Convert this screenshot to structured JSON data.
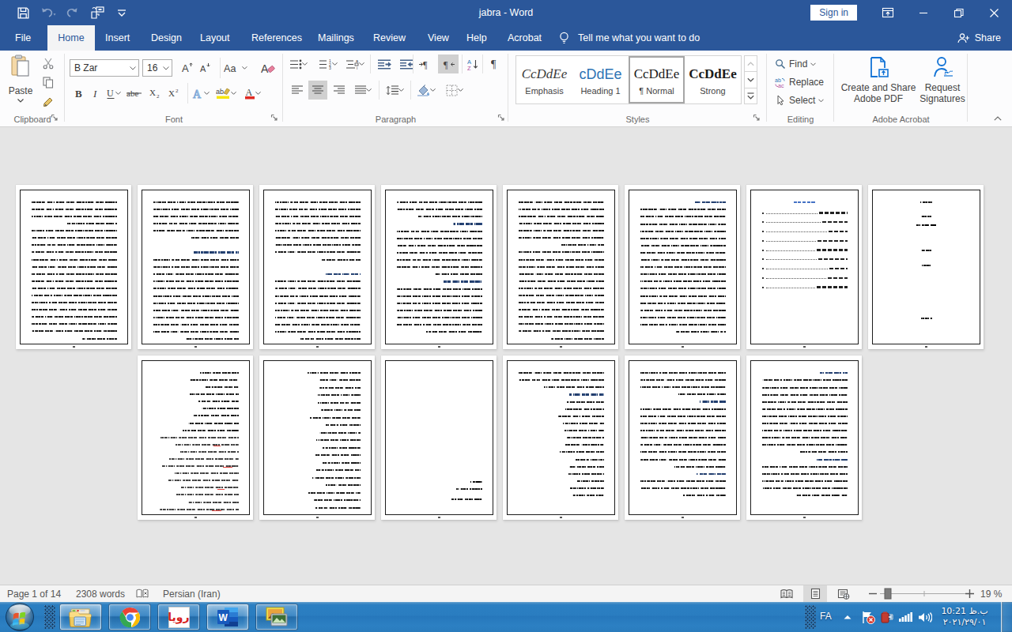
{
  "window": {
    "title": "jabra  -  Word",
    "signin_label": "Sign in"
  },
  "tabs": {
    "items": [
      {
        "label": "File",
        "active": false
      },
      {
        "label": "Home",
        "active": true
      },
      {
        "label": "Insert",
        "active": false
      },
      {
        "label": "Design",
        "active": false
      },
      {
        "label": "Layout",
        "active": false
      },
      {
        "label": "References",
        "active": false
      },
      {
        "label": "Mailings",
        "active": false
      },
      {
        "label": "Review",
        "active": false
      },
      {
        "label": "View",
        "active": false
      },
      {
        "label": "Help",
        "active": false
      },
      {
        "label": "Acrobat",
        "active": false
      }
    ],
    "tellme_label": "Tell me what you want to do",
    "share_label": "Share"
  },
  "ribbon": {
    "clipboard": {
      "label": "Clipboard",
      "paste_label": "Paste"
    },
    "font": {
      "label": "Font",
      "font_name": "B Zar",
      "font_size": "16"
    },
    "paragraph": {
      "label": "Paragraph"
    },
    "styles": {
      "label": "Styles",
      "items": [
        {
          "sample": "CcDdEe",
          "name": "Emphasis",
          "kind": "emphasis",
          "selected": false
        },
        {
          "sample": "cDdEe",
          "name": "Heading 1",
          "kind": "heading1",
          "selected": false
        },
        {
          "sample": "CcDdEe",
          "name": "¶ Normal",
          "kind": "normal",
          "selected": true
        },
        {
          "sample": "CcDdEe",
          "name": "Strong",
          "kind": "strong",
          "selected": false
        }
      ]
    },
    "editing": {
      "label": "Editing",
      "find_label": "Find",
      "replace_label": "Replace",
      "select_label": "Select"
    },
    "acrobat": {
      "label": "Adobe Acrobat",
      "create_pdf_label": "Create and Share\nAdobe PDF",
      "request_sig_label": "Request\nSignatures"
    }
  },
  "document": {
    "zoom_percent": 19,
    "rows": [
      8,
      6
    ],
    "pages": [
      {
        "kind": "body",
        "seed": 11,
        "blocks": [
          [
            "p",
            4,
            58
          ],
          [
            "p",
            16,
            40
          ]
        ]
      },
      {
        "kind": "body",
        "seed": 22,
        "blocks": [
          [
            "p",
            6,
            55
          ],
          [
            "g"
          ],
          [
            "h",
            52
          ],
          [
            "p",
            12,
            62
          ]
        ]
      },
      {
        "kind": "body",
        "seed": 33,
        "blocks": [
          [
            "p",
            9,
            45
          ],
          [
            "g"
          ],
          [
            "h",
            40
          ],
          [
            "p",
            9,
            70
          ]
        ]
      },
      {
        "kind": "body",
        "seed": 44,
        "blocks": [
          [
            "p",
            3,
            75
          ],
          [
            "h",
            34
          ],
          [
            "p",
            7,
            55
          ],
          [
            "h",
            46
          ],
          [
            "p",
            7,
            65
          ]
        ]
      },
      {
        "kind": "body",
        "seed": 55,
        "blocks": [
          [
            "p",
            7,
            50
          ],
          [
            "p",
            13,
            62
          ]
        ]
      },
      {
        "kind": "body",
        "seed": 66,
        "blocks": [
          [
            "h",
            36
          ],
          [
            "p",
            18,
            58
          ]
        ]
      },
      {
        "kind": "toc",
        "seed": 77,
        "entries": 9,
        "heading_w": 26
      },
      {
        "kind": "title",
        "seed": 88
      },
      {
        "kind": "refs",
        "seed": 99,
        "persian_lines": 9,
        "latin_lines": 11
      },
      {
        "kind": "list",
        "seed": 111,
        "lines": 19,
        "wmin": 38,
        "wmax": 62
      },
      {
        "kind": "sparse",
        "seed": 122,
        "at": 76,
        "heading_w": 13,
        "lines": [
          30,
          36
        ]
      },
      {
        "kind": "body",
        "seed": 133,
        "blocks": [
          [
            "p",
            3,
            70
          ],
          [
            "h",
            40
          ],
          [
            "list",
            14,
            30,
            55
          ]
        ]
      },
      {
        "kind": "body",
        "seed": 144,
        "blocks": [
          [
            "p",
            4,
            55
          ],
          [
            "h",
            30
          ],
          [
            "p",
            9,
            60
          ],
          [
            "h",
            34
          ],
          [
            "p",
            3,
            50
          ]
        ]
      },
      {
        "kind": "body",
        "seed": 155,
        "blocks": [
          [
            "h",
            32
          ],
          [
            "p",
            11,
            55
          ],
          [
            "h",
            36
          ],
          [
            "p",
            5,
            60
          ]
        ]
      }
    ]
  },
  "statusbar": {
    "page_indicator": "Page 1 of 14",
    "word_count": "2308 words",
    "language": "Persian (Iran)",
    "zoom_label": "19 %"
  },
  "taskbar": {
    "language_badge": "FA",
    "clock_time": "ب.ظ 10:21",
    "clock_date": "۲۰۲۱/۲۹/۰۱",
    "word_icon_letter": "W",
    "roya_label": "رویا"
  }
}
